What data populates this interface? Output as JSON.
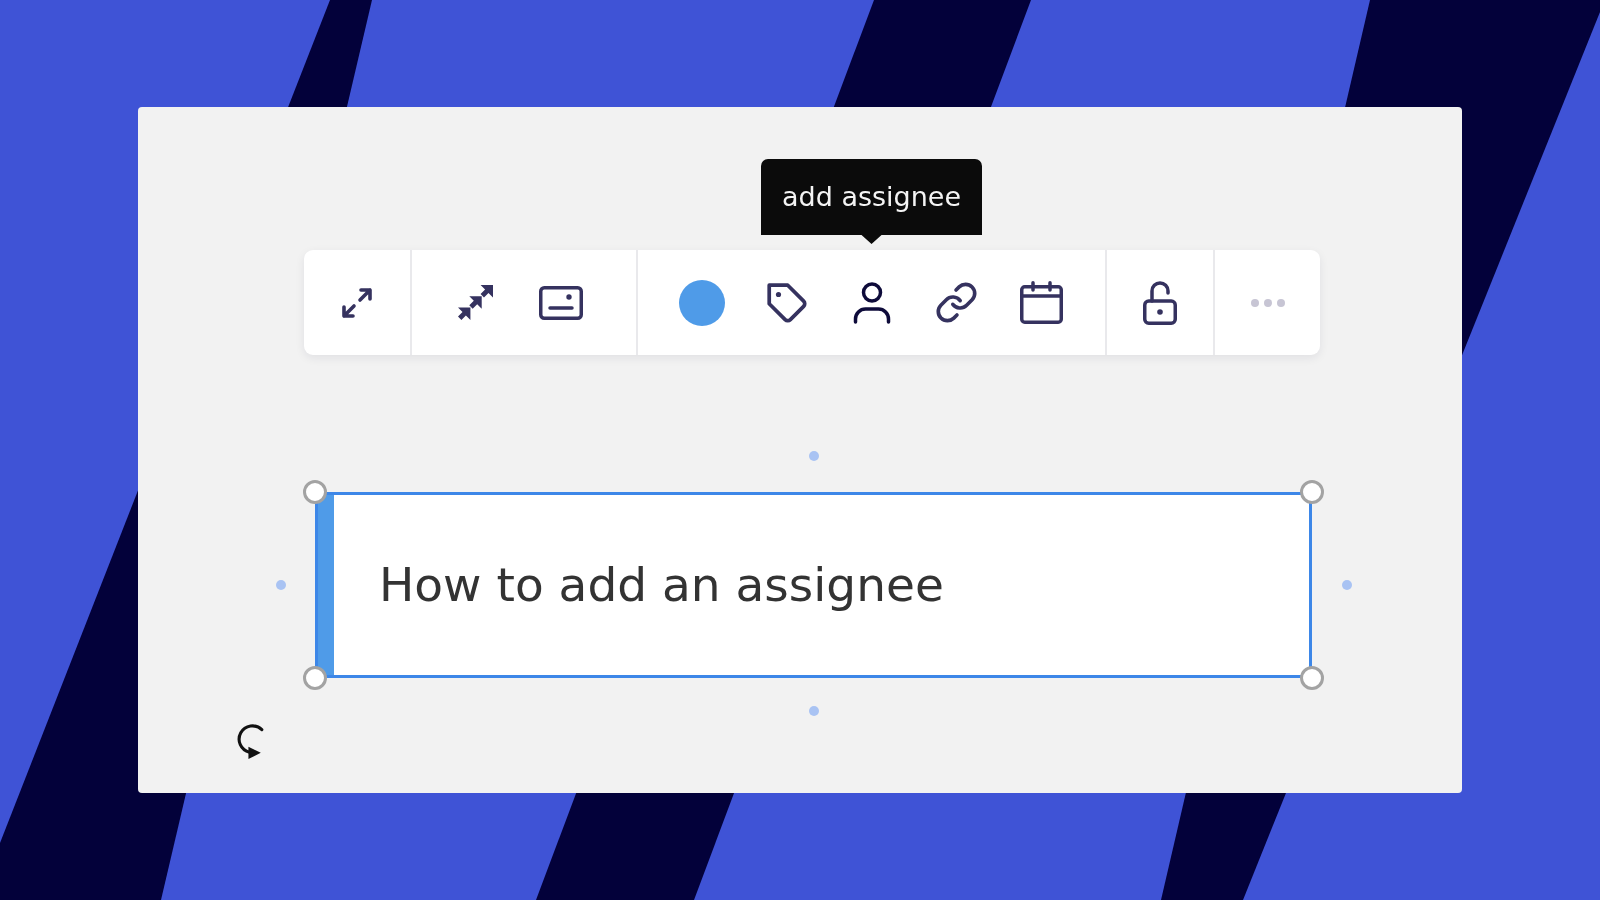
{
  "tooltip": {
    "text": "add assignee"
  },
  "toolbar": {
    "groups": [
      {
        "items": [
          {
            "kind": "expand",
            "hovered": false
          }
        ]
      },
      {
        "items": [
          {
            "kind": "arrows",
            "hovered": false
          },
          {
            "kind": "card",
            "hovered": false
          }
        ]
      },
      {
        "items": [
          {
            "kind": "color",
            "color": "#4f9be8",
            "hovered": false
          },
          {
            "kind": "tag",
            "hovered": false
          },
          {
            "kind": "assignee",
            "hovered": true
          },
          {
            "kind": "link",
            "hovered": false
          },
          {
            "kind": "date",
            "hovered": false
          }
        ]
      },
      {
        "items": [
          {
            "kind": "lock",
            "hovered": false
          }
        ]
      },
      {
        "items": [
          {
            "kind": "more",
            "hovered": false
          }
        ]
      }
    ]
  },
  "card": {
    "title": "How to add an assignee",
    "selected": true
  }
}
